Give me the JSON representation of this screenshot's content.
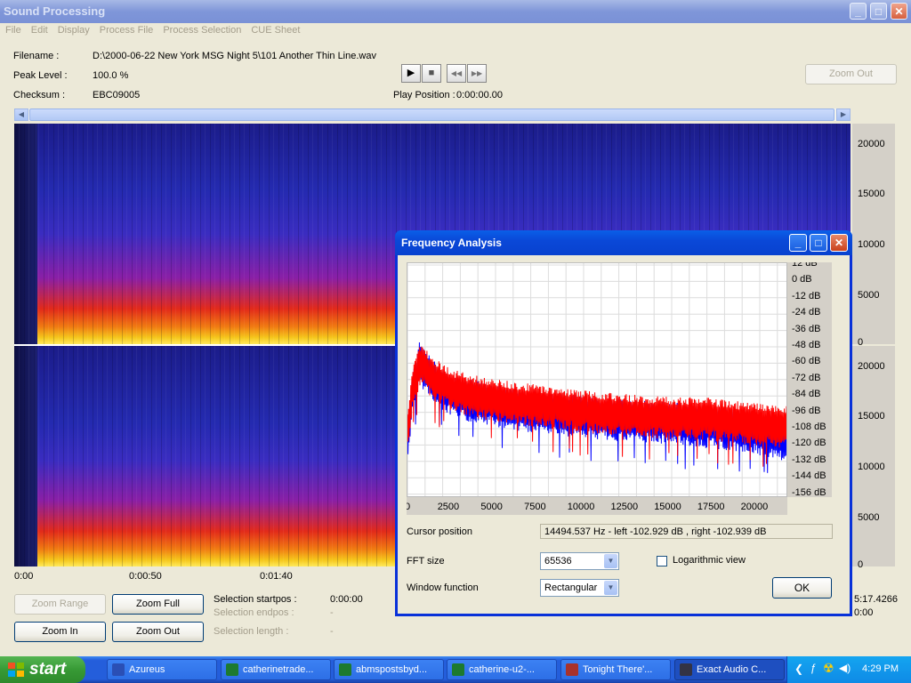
{
  "window": {
    "title": "Sound Processing",
    "buttons": {
      "minimize": "_",
      "maximize": "□",
      "close": "✕"
    }
  },
  "menu": [
    "File",
    "Edit",
    "Display",
    "Process File",
    "Process Selection",
    "CUE Sheet"
  ],
  "info": {
    "filename_label": "Filename :",
    "filename_value": "D:\\2000-06-22 New York MSG Night 5\\101 Another Thin Line.wav",
    "peak_label": "Peak Level :",
    "peak_value": "100.0 %",
    "checksum_label": "Checksum :",
    "checksum_value": "EBC09005",
    "play_position_label": "Play Position :",
    "play_position_value": "0:00:00.00"
  },
  "transport": {
    "play": "▶",
    "stop": "■",
    "rewind": "◀◀",
    "forward": "▶▶"
  },
  "zoom_out_top": "Zoom Out",
  "freq_axis_top": [
    "20000",
    "15000",
    "10000",
    "5000",
    "0"
  ],
  "freq_axis_bottom": [
    "20000",
    "15000",
    "10000",
    "5000",
    "0"
  ],
  "time_axis": [
    "0:00",
    "0:00:50",
    "0:01:40"
  ],
  "bottom_controls": {
    "zoom_range": "Zoom Range",
    "zoom_full": "Zoom Full",
    "zoom_in": "Zoom In",
    "zoom_out": "Zoom Out",
    "selection_startpos_label": "Selection startpos :",
    "selection_startpos_value": "0:00:00",
    "selection_endpos_label": "Selection endpos :",
    "selection_endpos_value": "-",
    "selection_length_label": "Selection length :",
    "selection_length_value": "-",
    "total_length": "5:17.4266",
    "right_zero": "0:00"
  },
  "dialog": {
    "title": "Frequency Analysis",
    "cursor_label": "Cursor position",
    "cursor_value": "14494.537 Hz  -  left -102.929 dB , right -102.939 dB",
    "fft_label": "FFT size",
    "fft_value": "65536",
    "log_label": "Logarithmic view",
    "log_checked": false,
    "window_label": "Window function",
    "window_value": "Rectangular",
    "ok": "OK"
  },
  "chart_data": {
    "type": "line",
    "title": "",
    "xlabel": "",
    "ylabel": "",
    "x_ticks": [
      "0",
      "2500",
      "5000",
      "7500",
      "10000",
      "12500",
      "15000",
      "17500",
      "20000"
    ],
    "y_ticks": [
      "12 dB",
      "0 dB",
      "-12 dB",
      "-24 dB",
      "-36 dB",
      "-48 dB",
      "-60 dB",
      "-72 dB",
      "-84 dB",
      "-96 dB",
      "-108 dB",
      "-120 dB",
      "-132 dB",
      "-144 dB",
      "-156 dB"
    ],
    "xlim": [
      0,
      22050
    ],
    "ylim": [
      -160,
      15
    ],
    "grid": true,
    "series": [
      {
        "channel": "left",
        "color": "#0000ff",
        "x": [
          0,
          300,
          700,
          1000,
          1400,
          1800,
          2500,
          3500,
          5000,
          7500,
          10000,
          12500,
          15000,
          17500,
          20000,
          22050
        ],
        "y": [
          -118,
          -80,
          -58,
          -64,
          -70,
          -76,
          -82,
          -86,
          -90,
          -95,
          -98,
          -101,
          -103,
          -106,
          -110,
          -116
        ]
      },
      {
        "channel": "right",
        "color": "#ff0000",
        "x": [
          0,
          300,
          700,
          1000,
          1400,
          1800,
          2500,
          3500,
          5000,
          7500,
          10000,
          12500,
          15000,
          17500,
          20000,
          22050
        ],
        "y": [
          -112,
          -76,
          -60,
          -62,
          -68,
          -72,
          -78,
          -82,
          -86,
          -90,
          -94,
          -97,
          -99,
          -100,
          -104,
          -106
        ]
      }
    ]
  },
  "taskbar": {
    "start": "start",
    "tasks": [
      {
        "label": "Azureus",
        "color": "#2a4fb5"
      },
      {
        "label": "catherinetrade...",
        "color": "#1d7a2f"
      },
      {
        "label": "abmspostsbyd...",
        "color": "#1d7a2f"
      },
      {
        "label": "catherine-u2-...",
        "color": "#1d7a2f"
      },
      {
        "label": "Tonight There'...",
        "color": "#a8322c"
      },
      {
        "label": "Exact Audio C...",
        "color": "#334"
      }
    ],
    "clock": "4:29 PM"
  }
}
